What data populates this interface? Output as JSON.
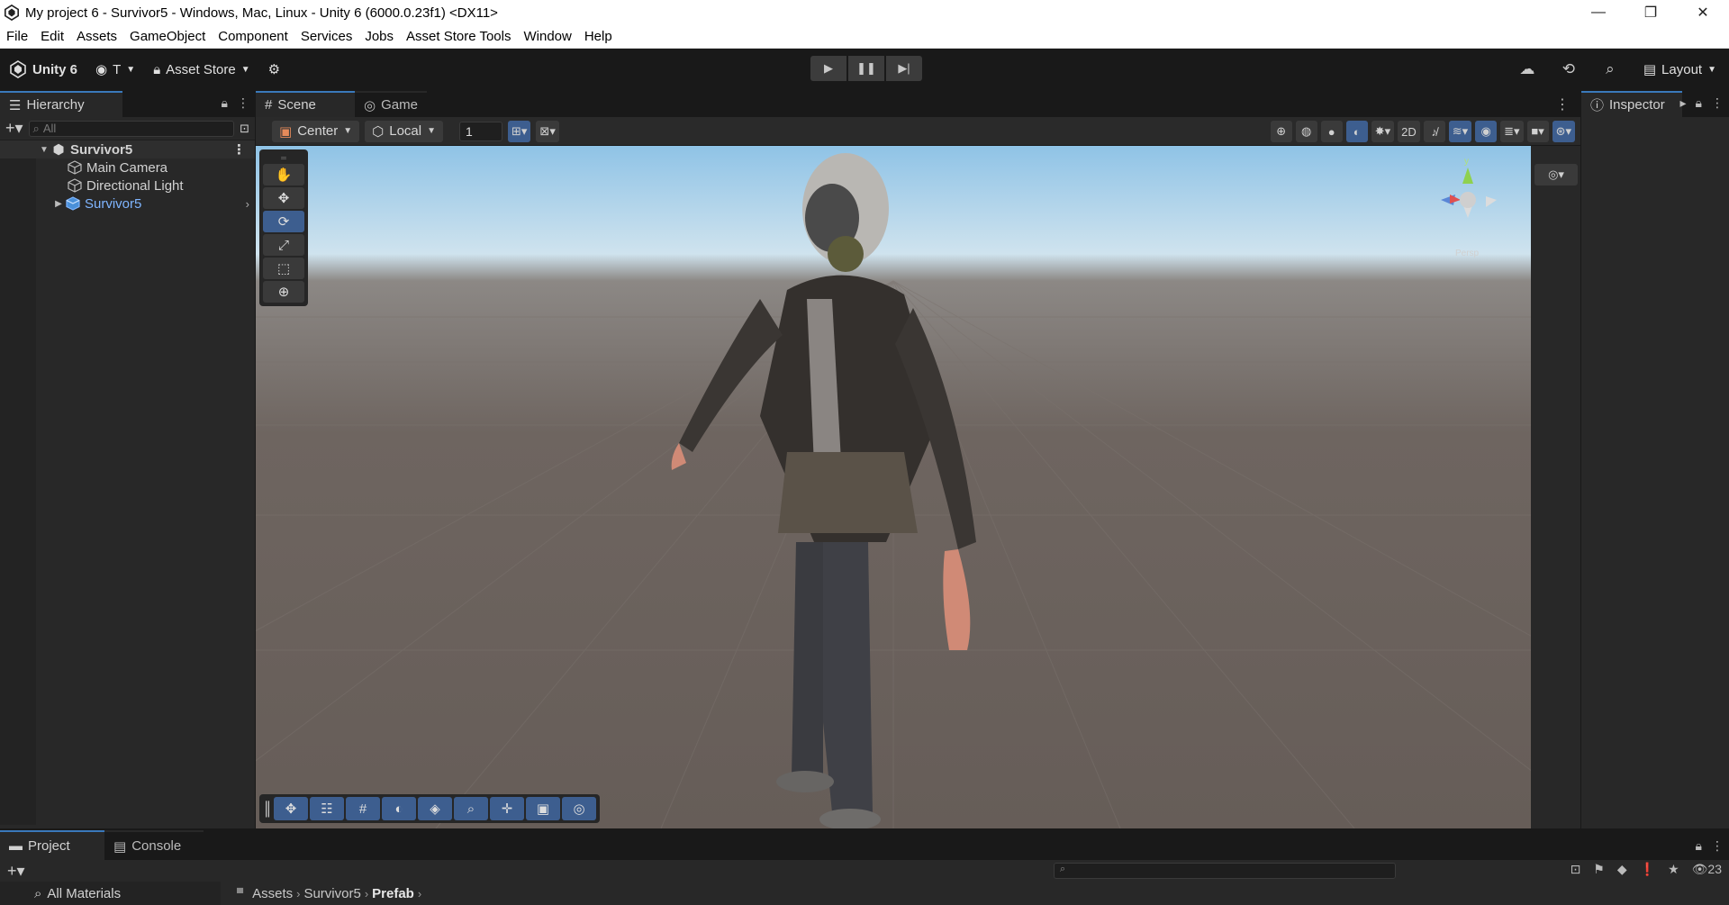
{
  "window": {
    "title": "My project 6 - Survivor5 - Windows, Mac, Linux - Unity 6 (6000.0.23f1) <DX11>",
    "controls": [
      "—",
      "❐",
      "✕"
    ]
  },
  "menu": [
    "File",
    "Edit",
    "Assets",
    "GameObject",
    "Component",
    "Services",
    "Jobs",
    "Asset Store Tools",
    "Window",
    "Help"
  ],
  "toolbar": {
    "brand": "Unity 6",
    "account": "T",
    "asset_store": "Asset Store",
    "layout": "Layout"
  },
  "hierarchy": {
    "tab": "Hierarchy",
    "search_placeholder": "All",
    "scene": "Survivor5",
    "items": [
      {
        "label": "Main Camera"
      },
      {
        "label": "Directional Light"
      },
      {
        "label": "Survivor5"
      }
    ]
  },
  "scene": {
    "tabs": [
      "Scene",
      "Game"
    ],
    "pivot": "Center",
    "space": "Local",
    "grid_snap": "1",
    "gizmo_label": "Persp"
  },
  "inspector": {
    "tab": "Inspector"
  },
  "project": {
    "tabs": [
      "Project",
      "Console"
    ],
    "left_item": "All Materials",
    "breadcrumb": [
      "Assets",
      "Survivor5",
      "Prefab"
    ],
    "count": "23"
  },
  "colors": {
    "accent": "#3a79bb",
    "prefab_text": "#7fb5ff",
    "panel": "#282828",
    "toolbar": "#191919"
  }
}
